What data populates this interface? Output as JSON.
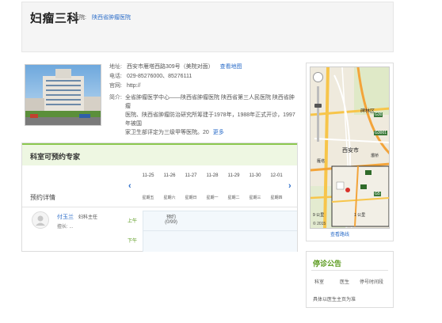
{
  "header": {
    "dept_title": "妇瘤三科",
    "hospital_prefix": "医院:",
    "hospital_name": "陕西省肿瘤医院"
  },
  "info": {
    "address_label": "地址:",
    "address_value": "西安市雁塔西路309号（美院对面）",
    "map_link": "查看地图",
    "phone_label": "电话:",
    "phone_value": "029-85276000、85276111",
    "website_label": "官网:",
    "website_value": "http://",
    "intro_label": "简介:",
    "intro_lines": [
      "全省肿瘤医学中心——陕西省肿瘤医院 陕西省第三人民医院 陕西省肿瘤",
      "医院、陕西省肿瘤防治研究所筹建于1978年，1988年正式开诊，1997年被国",
      "家卫生部评定为三级甲等医院。20"
    ],
    "more_link": "更多"
  },
  "appointment": {
    "title": "科室可预约专家",
    "detail_label": "预约详情",
    "prev_arrow": "‹",
    "next_arrow": "›",
    "dates": [
      "11-25",
      "11-26",
      "11-27",
      "11-28",
      "11-29",
      "11-30",
      "12-01"
    ],
    "days": [
      "星期五",
      "星期六",
      "星期日",
      "星期一",
      "星期二",
      "星期三",
      "星期四"
    ],
    "morning_label": "上午",
    "afternoon_label": "下午",
    "doctor": {
      "name": "付玉兰",
      "dept": "妇科主任",
      "specialty": "擅长: ...",
      "slot_label": "预约",
      "slot_count": "(0/99)"
    }
  },
  "map": {
    "link": "查看路线",
    "labels": [
      "西安市",
      "碑林区",
      "雁塔",
      "灞桥",
      "G3001",
      "G30",
      "G5",
      "9 公里",
      "1 公里",
      "© 2015"
    ]
  },
  "notice": {
    "title": "停诊公告",
    "headers": [
      "科室",
      "医生",
      "停号时间段"
    ],
    "text": "具体以医生主页为准"
  },
  "colors": {
    "accent_green": "#8cc850",
    "link_blue": "#2d6ec9",
    "header_bg": "#f5f5f5",
    "appt_head_bg": "#eef7e2"
  }
}
